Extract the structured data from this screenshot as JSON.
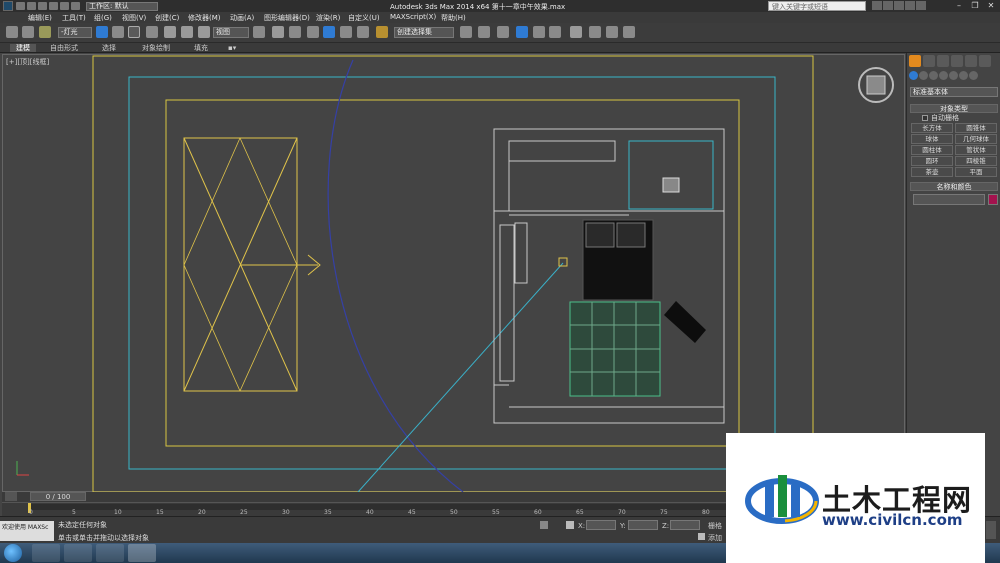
{
  "titlebar": {
    "workspace": "工作区: 默认",
    "title": "Autodesk 3ds Max  2014 x64      第十一章中午效果.max",
    "search_placeholder": "键入关键字或短语"
  },
  "menus": [
    "编辑(E)",
    "工具(T)",
    "组(G)",
    "视图(V)",
    "创建(C)",
    "修改器(M)",
    "动画(A)",
    "图形编辑器(D)",
    "渲染(R)",
    "自定义(U)",
    "MAXScript(X)",
    "帮助(H)"
  ],
  "toolbar": {
    "filter": "-灯光",
    "ref_coord": "视图",
    "named_selection": "创建选择集"
  },
  "ribbon": {
    "tabs": [
      "建模",
      "自由形式",
      "选择",
      "对象绘制",
      "填充"
    ]
  },
  "viewport": {
    "label": "[+][顶][线框]"
  },
  "cmdpanel": {
    "category": "标准基本体",
    "object_type_title": "对象类型",
    "autogrid": "自动栅格",
    "primitives": [
      "长方体",
      "圆锥体",
      "球体",
      "几何球体",
      "圆柱体",
      "管状体",
      "圆环",
      "四棱锥",
      "茶壶",
      "平面"
    ],
    "name_color_title": "名称和颜色",
    "object_color": "#a3124e"
  },
  "timeline": {
    "frame_label": "0 / 100",
    "ticks": [
      "0",
      "5",
      "10",
      "15",
      "20",
      "25",
      "30",
      "35",
      "40",
      "45",
      "50",
      "55",
      "60",
      "65",
      "70",
      "75",
      "80"
    ]
  },
  "status": {
    "selection": "未选定任何对象",
    "prompt": "单击或单击并拖动以选择对象",
    "x_label": "X:",
    "y_label": "Y:",
    "z_label": "Z:",
    "grid_label": "栅格",
    "add_time_tag": "添加",
    "maxscript_mini": "欢迎使用 MAXSc"
  },
  "watermark": {
    "brand": "土木工程网",
    "url": "www.civilcn.com"
  },
  "colors": {
    "accent_active": "#2f7bd3",
    "cmd_tab_active": "#e38a1e",
    "light_gizmo": "#e0c34a",
    "camera_line": "#3ab0c8"
  }
}
